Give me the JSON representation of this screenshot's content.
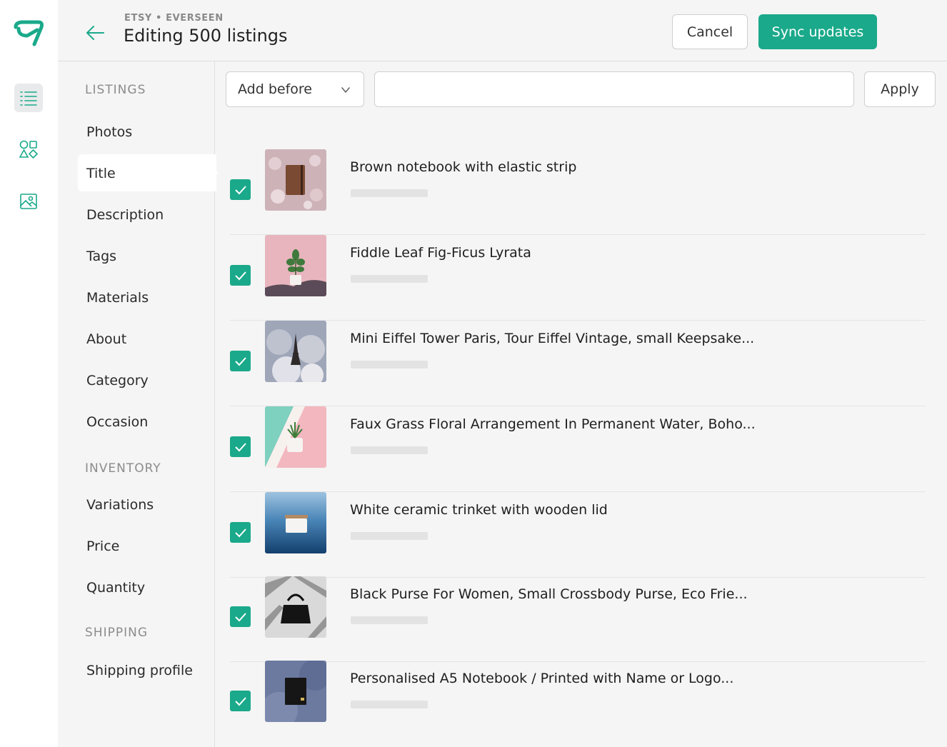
{
  "header": {
    "breadcrumb": "ETSY • EVERSEEN",
    "title": "Editing 500 listings",
    "cancel_label": "Cancel",
    "sync_label": "Sync updates"
  },
  "rail": {
    "items": [
      {
        "icon": "list-icon",
        "active": true
      },
      {
        "icon": "shapes-icon",
        "active": false
      },
      {
        "icon": "image-icon",
        "active": false
      }
    ]
  },
  "subnav": {
    "sections": [
      {
        "title": "LISTINGS",
        "items": [
          "Photos",
          "Title",
          "Description",
          "Tags",
          "Materials",
          "About",
          "Category",
          "Occasion"
        ]
      },
      {
        "title": "INVENTORY",
        "items": [
          "Variations",
          "Price",
          "Quantity"
        ]
      },
      {
        "title": "SHIPPING",
        "items": [
          "Shipping profile"
        ]
      }
    ],
    "selected": "Title"
  },
  "toolbar": {
    "mode_value": "Add before",
    "text_value": "",
    "apply_label": "Apply"
  },
  "listings": [
    {
      "title": "Brown notebook with elastic strip",
      "checked": true,
      "thumb": "notebook"
    },
    {
      "title": "Fiddle Leaf Fig-Ficus Lyrata",
      "checked": true,
      "thumb": "plant-pink"
    },
    {
      "title": "Mini Eiffel Tower Paris, Tour Eiffel Vintage, small Keepsake...",
      "checked": true,
      "thumb": "eiffel"
    },
    {
      "title": "Faux Grass Floral Arrangement In Permanent Water, Boho...",
      "checked": true,
      "thumb": "grass"
    },
    {
      "title": "White ceramic trinket with wooden lid",
      "checked": true,
      "thumb": "trinket"
    },
    {
      "title": "Black Purse For Women, Small Crossbody Purse, Eco Frie...",
      "checked": true,
      "thumb": "purse"
    },
    {
      "title": "Personalised A5 Notebook / Printed with Name or Logo...",
      "checked": true,
      "thumb": "a5-notebook"
    }
  ],
  "colors": {
    "accent": "#1aa98a",
    "background": "#f5f5f5",
    "border": "#cfcfcf"
  }
}
